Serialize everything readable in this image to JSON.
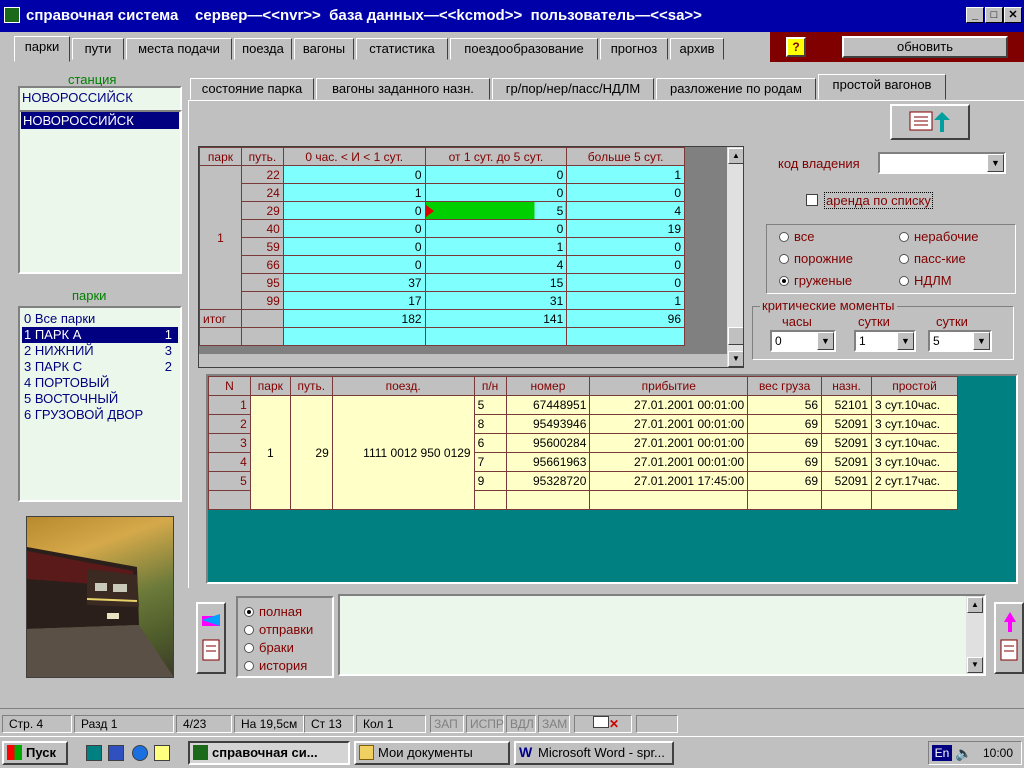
{
  "window": {
    "title": "справочная система    сервер—<<nvr>>  база данных—<<kcmod>>  пользователь—<<sa>>"
  },
  "main_tabs": [
    "парки",
    "пути",
    "места подачи",
    "поезда",
    "вагоны",
    "статистика",
    "поездообразование",
    "прогноз",
    "архив"
  ],
  "toolbar": {
    "help_label": "?",
    "refresh_label": "обновить"
  },
  "station": {
    "label": "станция",
    "value": "НОВОРОССИЙСК",
    "selected": "НОВОРОССИЙСК"
  },
  "parks": {
    "label": "парки",
    "items": [
      {
        "text": "0  Все парки",
        "count": ""
      },
      {
        "text": "1  ПАРК А",
        "count": "1"
      },
      {
        "text": "2  НИЖНИЙ",
        "count": "3"
      },
      {
        "text": "3  ПАРК С",
        "count": "2"
      },
      {
        "text": "4  ПОРТОВЫЙ",
        "count": ""
      },
      {
        "text": "5  ВОСТОЧНЫЙ",
        "count": ""
      },
      {
        "text": "6  ГРУЗОВОЙ ДВОР",
        "count": ""
      }
    ],
    "selected_index": 1
  },
  "sub_tabs": [
    "состояние парка",
    "вагоны заданного назн.",
    "гр/пор/нер/пасс/НДЛМ",
    "разложение по родам",
    "простой вагонов"
  ],
  "table1": {
    "headers": [
      "парк",
      "путь.",
      "0 час. < И < 1 сут.",
      "от 1 сут. до 5 сут.",
      "больше 5 сут."
    ],
    "park": "1",
    "rows": [
      {
        "track": "22",
        "a": "0",
        "b": "0",
        "c": "1"
      },
      {
        "track": "24",
        "a": "1",
        "b": "0",
        "c": "0"
      },
      {
        "track": "29",
        "a": "0",
        "b": "5",
        "c": "4"
      },
      {
        "track": "40",
        "a": "0",
        "b": "0",
        "c": "19"
      },
      {
        "track": "59",
        "a": "0",
        "b": "1",
        "c": "0"
      },
      {
        "track": "66",
        "a": "0",
        "b": "4",
        "c": "0"
      },
      {
        "track": "95",
        "a": "37",
        "b": "15",
        "c": "0"
      },
      {
        "track": "99",
        "a": "17",
        "b": "31",
        "c": "1"
      }
    ],
    "total_label": "итог",
    "totals": {
      "a": "182",
      "b": "141",
      "c": "96"
    }
  },
  "ownership": {
    "label": "код владения",
    "value": ""
  },
  "rent": {
    "label": "аренда по списку",
    "checked": false
  },
  "filter": {
    "options": [
      {
        "label": "все",
        "on": false
      },
      {
        "label": "нерабочие",
        "on": false
      },
      {
        "label": "порожние",
        "on": false
      },
      {
        "label": "пасс-кие",
        "on": false
      },
      {
        "label": "груженые",
        "on": true
      },
      {
        "label": "НДЛМ",
        "on": false
      }
    ]
  },
  "critical": {
    "title": "критические моменты",
    "hours_label": "часы",
    "hours_value": "0",
    "days1_label": "сутки",
    "days1_value": "1",
    "days2_label": "сутки",
    "days2_value": "5"
  },
  "table2": {
    "headers": [
      "N",
      "парк",
      "путь.",
      "поезд.",
      "п/н",
      "номер",
      "прибытие",
      "вес груза",
      "назн.",
      "простой"
    ],
    "park": "1",
    "track": "29",
    "train": "1111 0012 950 0129",
    "rows": [
      {
        "n": "1",
        "pos": "5",
        "num": "67448951",
        "arr": "27.01.2001  00:01:00",
        "weight": "56",
        "dest": "52101",
        "idle": "3 сут.10час."
      },
      {
        "n": "2",
        "pos": "8",
        "num": "95493946",
        "arr": "27.01.2001  00:01:00",
        "weight": "69",
        "dest": "52091",
        "idle": "3 сут.10час."
      },
      {
        "n": "3",
        "pos": "6",
        "num": "95600284",
        "arr": "27.01.2001  00:01:00",
        "weight": "69",
        "dest": "52091",
        "idle": "3 сут.10час."
      },
      {
        "n": "4",
        "pos": "7",
        "num": "95661963",
        "arr": "27.01.2001  00:01:00",
        "weight": "69",
        "dest": "52091",
        "idle": "3 сут.10час."
      },
      {
        "n": "5",
        "pos": "9",
        "num": "95328720",
        "arr": "27.01.2001  17:45:00",
        "weight": "69",
        "dest": "52091",
        "idle": "2 сут.17час."
      }
    ]
  },
  "mode": {
    "options": [
      {
        "label": "полная",
        "on": true
      },
      {
        "label": "отправки",
        "on": false
      },
      {
        "label": "браки",
        "on": false
      },
      {
        "label": "история",
        "on": false
      }
    ]
  },
  "statusbar": {
    "page": "Стр. 4",
    "section": "Разд 1",
    "pages": "4/23",
    "at": "На 19,5см",
    "line": "Ст 13",
    "col": "Кол 1",
    "rec": "ЗАП",
    "trk": "ИСПР",
    "ext": "ВДЛ",
    "ovr": "ЗАМ"
  },
  "taskbar": {
    "start": "Пуск",
    "tasks": [
      "справочная си...",
      "Мои документы",
      "Microsoft Word - spr..."
    ],
    "lang": "En",
    "clock": "10:00"
  }
}
